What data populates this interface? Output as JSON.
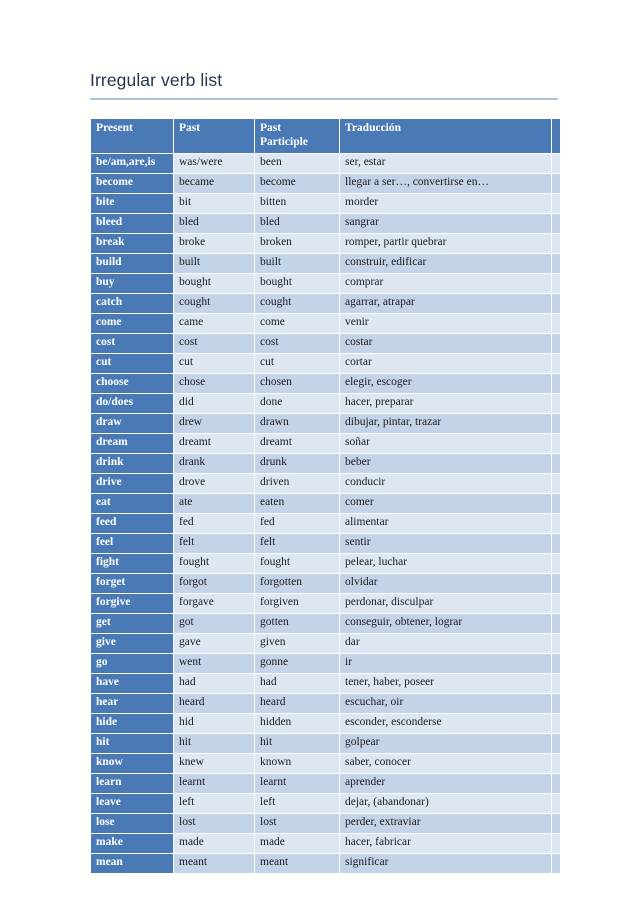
{
  "document": {
    "title": "Irregular verb list"
  },
  "table": {
    "columns": [
      "Present",
      "Past",
      "Past Participle",
      "Traducción"
    ],
    "headers": {
      "present": "Present",
      "past": "Past",
      "past_participle_line1": "Past",
      "past_participle_line2": "Participle",
      "traduccion": "Traducción"
    },
    "rows": [
      [
        "be/am,are,is",
        "was/were",
        "been",
        "ser, estar"
      ],
      [
        "become",
        "became",
        "become",
        "llegar a ser…, convertirse en…"
      ],
      [
        "bite",
        "bit",
        "bitten",
        "morder"
      ],
      [
        "bleed",
        "bled",
        "bled",
        "sangrar"
      ],
      [
        "break",
        "broke",
        "broken",
        "romper, partir  quebrar"
      ],
      [
        "build",
        "built",
        "built",
        "construir, edificar"
      ],
      [
        "buy",
        "bought",
        "bought",
        "comprar"
      ],
      [
        "catch",
        "cought",
        "cought",
        "agarrar, atrapar"
      ],
      [
        "come",
        "came",
        "come",
        "venir"
      ],
      [
        "cost",
        "cost",
        "cost",
        "costar"
      ],
      [
        "cut",
        "cut",
        "cut",
        "cortar"
      ],
      [
        "choose",
        "chose",
        "chosen",
        "elegir, escoger"
      ],
      [
        "do/does",
        "did",
        "done",
        "hacer, preparar"
      ],
      [
        "draw",
        "drew",
        "drawn",
        "dibujar, pintar, trazar"
      ],
      [
        "dream",
        "dreamt",
        "dreamt",
        "soñar"
      ],
      [
        "drink",
        "drank",
        "drunk",
        "beber"
      ],
      [
        "drive",
        "drove",
        "driven",
        "conducir"
      ],
      [
        "eat",
        "ate",
        "eaten",
        "comer"
      ],
      [
        "feed",
        "fed",
        "fed",
        "alimentar"
      ],
      [
        "feel",
        "felt",
        "felt",
        "sentir"
      ],
      [
        "fight",
        "fought",
        "fought",
        "pelear, luchar"
      ],
      [
        "forget",
        "forgot",
        "forgotten",
        "olvidar"
      ],
      [
        "forgive",
        "forgave",
        "forgiven",
        "perdonar, disculpar"
      ],
      [
        "get",
        "got",
        "gotten",
        "conseguir, obtener, lograr"
      ],
      [
        "give",
        "gave",
        "given",
        "dar"
      ],
      [
        "go",
        "went",
        "gonne",
        "ir"
      ],
      [
        "have",
        "had",
        "had",
        "tener, haber, poseer"
      ],
      [
        "hear",
        "heard",
        "heard",
        "escuchar, oir"
      ],
      [
        "hide",
        "hid",
        "hidden",
        "esconder, esconderse"
      ],
      [
        "hit",
        "hit",
        "hit",
        "golpear"
      ],
      [
        "know",
        "knew",
        "known",
        "saber, conocer"
      ],
      [
        "learn",
        "learnt",
        "learnt",
        "aprender"
      ],
      [
        "leave",
        "left",
        "left",
        "dejar, (abandonar)"
      ],
      [
        "lose",
        "lost",
        "lost",
        "perder, extraviar"
      ],
      [
        "make",
        "made",
        "made",
        "hacer, fabricar"
      ],
      [
        "mean",
        "meant",
        "meant",
        "significar"
      ]
    ]
  },
  "colors": {
    "header_blue": "#4a7ab5",
    "row_light": "#dde7f3",
    "row_medium": "#c3d4e8",
    "title_text": "#24364f",
    "rule": "#a9c2dd"
  }
}
